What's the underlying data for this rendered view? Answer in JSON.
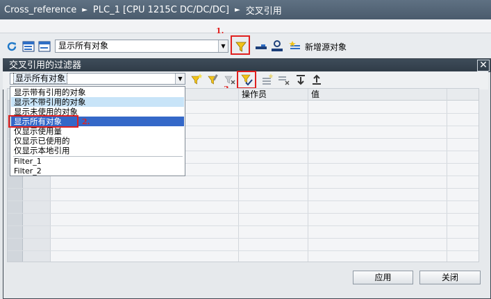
{
  "titlebar": {
    "crumb1": "Cross_reference",
    "crumb2": "PLC_1 [CPU 1215C DC/DC/DC]",
    "crumb3": "交叉引用",
    "separator": "►"
  },
  "toolbar": {
    "display_combo_value": "显示所有对象",
    "new_source_label": "新增源对象"
  },
  "annotations": {
    "step1": "1.",
    "step2": "2.",
    "step3": "3."
  },
  "dialog": {
    "title": "交叉引用的过滤器",
    "close_glyph": "✕",
    "filter_combo_value": "显示所有对象",
    "filter_options": [
      "显示带有引用的对象",
      "显示不带引用的对象",
      "显示未使用的对象",
      "显示所有对象",
      "仅显示使用量",
      "仅显示已使用的",
      "仅显示本地引用"
    ],
    "custom_filters": [
      "Filter_1",
      "Filter_2"
    ],
    "selected_option": "显示所有对象",
    "hovered_option": "显示不带引用的对象",
    "columns": {
      "operator": "操作员",
      "value": "值"
    },
    "buttons": {
      "apply": "应用",
      "close": "关闭"
    }
  },
  "colors": {
    "annotation_red": "#e0201f",
    "selection_blue": "#3468c8",
    "hover_blue": "#c8e4f8",
    "titlebar": "#4a5b6c"
  }
}
